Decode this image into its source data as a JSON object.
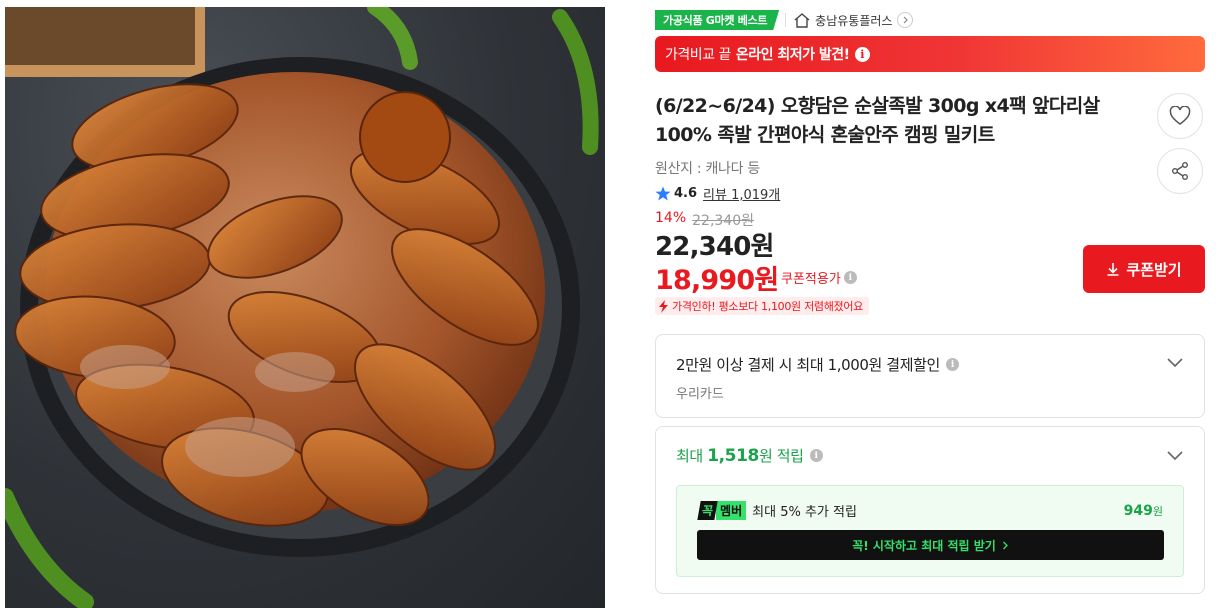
{
  "product_image": {
    "icon": "product-photo-jokbal"
  },
  "badges": {
    "best": "가공식품 G마켓 베스트",
    "store": "충남유통플러스",
    "store_icon": "home-icon"
  },
  "banner": {
    "prefix": "가격비교 끝",
    "highlight": "온라인 최저가 발견!",
    "icon": "info-icon"
  },
  "product": {
    "title": "(6/22~6/24) 오향담은 순살족발 300g x4팩 앞다리살100% 족발 간편야식 혼술안주 캠핑 밀키트",
    "origin": "원산지 : 캐나다 등",
    "rating": "4.6",
    "review_label": "리뷰",
    "review_count": "1,019개",
    "discount_pct": "14%",
    "original_price": "22,340원",
    "price": "22,340원",
    "coupon_price": "18,990원",
    "coupon_applied": "쿠폰적용가",
    "price_drop": "가격인하! 평소보다 1,100원 저렴해졌어요"
  },
  "actions": {
    "coupon_button": "쿠폰받기",
    "wish_icon": "heart-icon",
    "share_icon": "share-icon"
  },
  "card_discount": {
    "title": "2만원 이상 결제 시 최대 1,000원 결제할인",
    "card_name": "우리카드"
  },
  "points": {
    "prefix": "최대",
    "amount": "1,518",
    "suffix": "원 적립",
    "member_logo_a": "꼭",
    "member_logo_b": "멤버",
    "member_text": "최대 5% 추가 적립",
    "member_amount": "949",
    "member_unit": "원",
    "member_cta": "꼭! 시작하고 최대 적립 받기"
  },
  "colors": {
    "accent_red": "#e8191f",
    "accent_green": "#1aa34a",
    "member_green": "#35e06b"
  }
}
